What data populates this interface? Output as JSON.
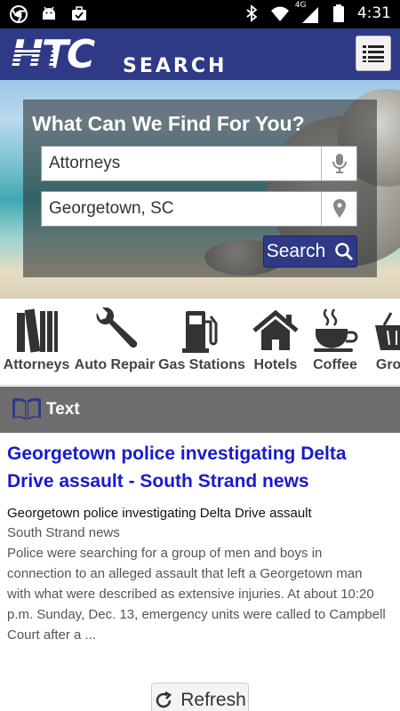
{
  "status_bar": {
    "time": "4:31",
    "network": "4G",
    "left_icons": [
      "chrome-icon",
      "android-debug-icon",
      "briefcase-icon"
    ],
    "right_icons": [
      "bluetooth-icon",
      "wifi-icon",
      "signal-icon",
      "battery-icon"
    ]
  },
  "header": {
    "logo_main": "HTC",
    "logo_sub": "SEARCH",
    "menu_icon": "list-menu-icon",
    "color": "#2e3a86"
  },
  "search": {
    "title": "What Can We Find For You?",
    "what_value": "Attorneys",
    "where_value": "Georgetown, SC",
    "what_icon": "microphone-icon",
    "where_icon": "location-pin-icon",
    "button_label": "Search",
    "button_icon": "magnifier-icon"
  },
  "categories": [
    {
      "label": "Attorneys",
      "icon": "books-icon"
    },
    {
      "label": "Auto Repair",
      "icon": "wrench-icon"
    },
    {
      "label": "Gas Stations",
      "icon": "gas-pump-icon"
    },
    {
      "label": "Hotels",
      "icon": "house-icon"
    },
    {
      "label": "Coffee",
      "icon": "coffee-cup-icon"
    },
    {
      "label": "Groce",
      "icon": "basket-icon"
    }
  ],
  "section": {
    "label": "Text",
    "icon": "open-book-icon"
  },
  "article": {
    "headline": "Georgetown police investigating Delta Drive assault - South Strand news",
    "subtitle": "Georgetown police investigating Delta Drive assault",
    "source": "South Strand news",
    "snippet": "Police were searching for a group of men and boys in connection to an alleged assault that left a Georgetown man with what were described as extensive injuries. At about 10:20 p.m. Sunday, Dec. 13, emergency units were called to Campbell Court after a ..."
  },
  "refresh": {
    "label": "Refresh",
    "icon": "refresh-icon"
  }
}
